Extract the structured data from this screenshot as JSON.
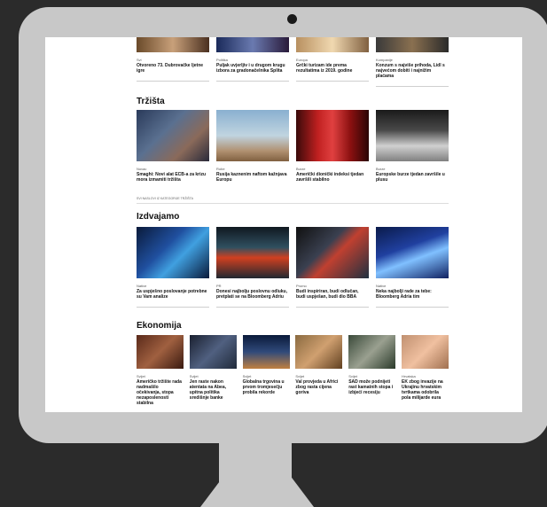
{
  "sections": {
    "top": {
      "cards": [
        {
          "category": "Svi",
          "title": "Otvoreno 73. Dubrovačke ljetne igre"
        },
        {
          "category": "Politika",
          "title": "Puljak uvjerljiv i u drugom krugu izbora za gradonačelnika Splita"
        },
        {
          "category": "Europa",
          "title": "Grčki turizam ide prema rezultatima iz 2019. godine"
        },
        {
          "category": "Kompanije",
          "title": "Konzum s najviše prihoda, Lidl s najvećom dobiti i najnižim plaćama"
        }
      ]
    },
    "trzista": {
      "title": "Tržišta",
      "cards": [
        {
          "category": "Novac",
          "title": "Smaghi: Novi alat ECB-a za krizu mora izmamiti tržišta"
        },
        {
          "category": "Robe",
          "title": "Rusija kaznenim naftom kažnjava Europu"
        },
        {
          "category": "Burze",
          "title": "Američki dionički indeksi tjedan završili stabilno"
        },
        {
          "category": "Burze",
          "title": "Europske burze tjedan završile u plusu"
        }
      ],
      "note": "SVI NASLOVI IZ KATEGORIJE TRŽIŠTA"
    },
    "izdvajamo": {
      "title": "Izdvajamo",
      "cards": [
        {
          "category": "Native",
          "title": "Za uspješno poslovanje potrebne su Vam analize"
        },
        {
          "category": "PR",
          "title": "Donesi najbolju poslovnu odluku, pretplati se na Bloomberg Adriu"
        },
        {
          "category": "Promo",
          "title": "Budi inspiriran, budi odlučan, budi uspješan, budi dio BBA"
        },
        {
          "category": "Native",
          "title": "Neka najbolji rade za tebe: Bloomberg Adria tim"
        }
      ]
    },
    "ekonomija": {
      "title": "Ekonomija",
      "cards": [
        {
          "category": "Svijet",
          "title": "Američko tržište rada nadmašilo očekivanja, stopa nezaposlenosti stabilna"
        },
        {
          "category": "Svijet",
          "title": "Jen raste nakon atentata na Abea, upitna politika središnje banke"
        },
        {
          "category": "Svijet",
          "title": "Globalna trgovina u prvom tromjesečju probila rekorde"
        },
        {
          "category": "Svijet",
          "title": "Val provjeda u Africi zbog rasta cijena goriva"
        },
        {
          "category": "Svijet",
          "title": "SAD može podnijeti rast kamatnih stopa i izbjeći recesiju"
        },
        {
          "category": "Hrvatska",
          "title": "EK zbog invazije na Ukrajinu hrvatskim tvrtkama odobrila pola milijarde eura"
        }
      ]
    }
  },
  "colors": {
    "screen_bg": "#ffffff",
    "frame": "#c8c8c8",
    "outer_bg": "#2b2b2b",
    "title": "#111111"
  }
}
